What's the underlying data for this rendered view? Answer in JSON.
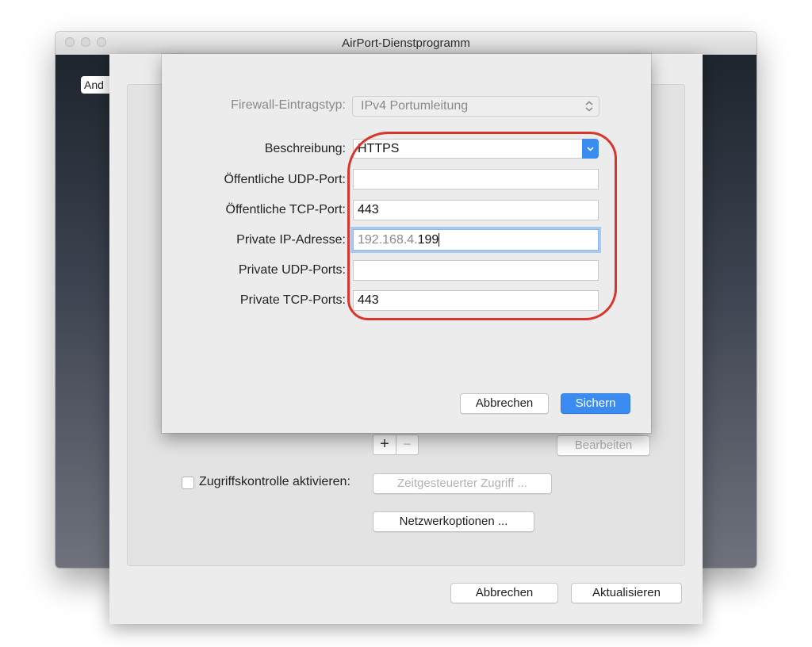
{
  "window": {
    "title": "AirPort-Dienstprogramm",
    "behind_button_label": "And"
  },
  "sheet": {
    "add_symbol": "+",
    "remove_symbol": "−",
    "bearbeiten_label": "Bearbeiten",
    "access_control_label": "Zugriffskontrolle aktivieren:",
    "access_control_checked": false,
    "timed_access_label": "Zeitgesteuerter Zugriff ...",
    "network_options_label": "Netzwerkoptionen ...",
    "cancel_label": "Abbrechen",
    "update_label": "Aktualisieren"
  },
  "dialog": {
    "firewall_type_label": "Firewall-Eintragstyp:",
    "firewall_type_value": "IPv4 Portumleitung",
    "description_label": "Beschreibung:",
    "description_value": "HTTPS",
    "public_udp_label": "Öffentliche UDP-Port:",
    "public_udp_value": "",
    "public_tcp_label": "Öffentliche TCP-Port:",
    "public_tcp_value": "443",
    "private_ip_label": "Private IP-Adresse:",
    "private_ip_prefix": "192.168.4.",
    "private_ip_suffix": "199",
    "private_udp_label": "Private UDP-Ports:",
    "private_udp_value": "",
    "private_tcp_label": "Private TCP-Ports:",
    "private_tcp_value": "443",
    "cancel_label": "Abbrechen",
    "save_label": "Sichern"
  },
  "colors": {
    "accent_blue": "#3b8cf0",
    "highlight_red": "#d9352b",
    "focus_ring": "#8fb9ee"
  }
}
